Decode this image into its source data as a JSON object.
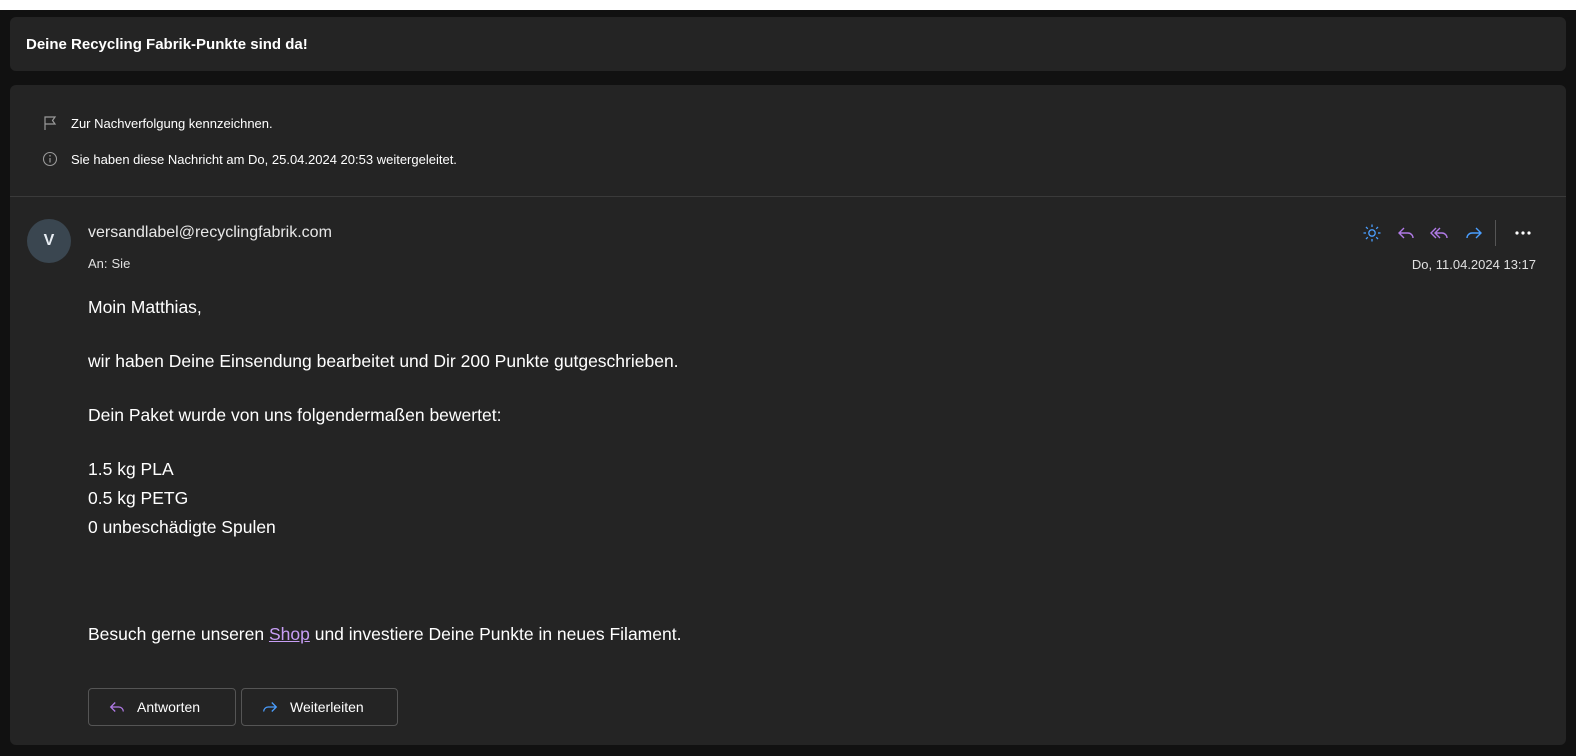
{
  "subject": "Deine Recycling Fabrik-Punkte sind da!",
  "info": {
    "flag_text": "Zur Nachverfolgung kennzeichnen.",
    "forward_notice": "Sie haben diese Nachricht am Do, 25.04.2024 20:53 weitergeleitet."
  },
  "message": {
    "avatar_initial": "V",
    "sender": "versandlabel@recyclingfabrik.com",
    "to_label": "An:",
    "to_value": "Sie",
    "date": "Do, 11.04.2024 13:17",
    "greeting": "Moin Matthias,",
    "line1": "wir haben Deine Einsendung bearbeitet und Dir 200 Punkte gutgeschrieben.",
    "line2": "Dein Paket wurde von uns folgendermaßen bewertet:",
    "items": [
      "1.5 kg PLA",
      "0.5 kg PETG",
      "0 unbeschädigte Spulen"
    ],
    "closing_before": "Besuch gerne unseren ",
    "closing_link": "Shop",
    "closing_after": " und investiere Deine Punkte in neues Filament."
  },
  "buttons": {
    "reply": "Antworten",
    "forward": "Weiterleiten"
  },
  "icons": {
    "flag": "flag-icon",
    "info": "info-icon",
    "summary": "sun-icon",
    "reply": "reply-icon",
    "reply_all": "reply-all-icon",
    "forward": "forward-icon",
    "more": "more-icon"
  },
  "colors": {
    "background": "#242424",
    "accent_blue": "#4a9eff",
    "accent_purple": "#b07ae6",
    "link": "#c79ef5"
  }
}
